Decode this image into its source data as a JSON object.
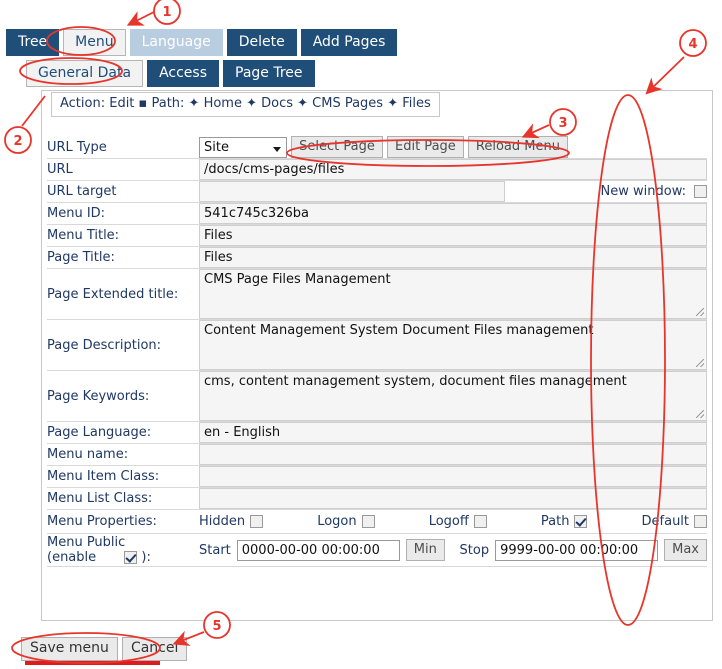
{
  "tabs_main": [
    {
      "label": "Tree",
      "state": "normal"
    },
    {
      "label": "Menu",
      "state": "active"
    },
    {
      "label": "Language",
      "state": "disabled"
    },
    {
      "label": "Delete",
      "state": "normal"
    },
    {
      "label": "Add Pages",
      "state": "normal"
    }
  ],
  "tabs_sub": [
    {
      "label": "General Data",
      "state": "active"
    },
    {
      "label": "Access",
      "state": "normal"
    },
    {
      "label": "Page Tree",
      "state": "normal"
    }
  ],
  "action_path": "Action: Edit ▪ Path: ✦ Home ✦ Docs ✦ CMS Pages ✦ Files",
  "form": {
    "url_type": {
      "label": "URL Type",
      "value": "Site",
      "buttons": [
        "Select Page",
        "Edit Page",
        "Reload Menu"
      ]
    },
    "url": {
      "label": "URL",
      "value": "/docs/cms-pages/files"
    },
    "url_target": {
      "label": "URL target",
      "value": "",
      "new_window_label": "New window:",
      "new_window_checked": false
    },
    "menu_id": {
      "label": "Menu ID:",
      "value": "541c745c326ba"
    },
    "menu_title": {
      "label": "Menu Title:",
      "value": "Files"
    },
    "page_title": {
      "label": "Page Title:",
      "value": "Files"
    },
    "page_extended_title": {
      "label": "Page Extended title:",
      "value": "CMS Page Files Management"
    },
    "page_description": {
      "label": "Page Description:",
      "value": "Content Management System Document Files management"
    },
    "page_keywords": {
      "label": "Page Keywords:",
      "value": "cms, content management system, document files management"
    },
    "page_language": {
      "label": "Page Language:",
      "value": "en - English"
    },
    "menu_name": {
      "label": "Menu name:",
      "value": ""
    },
    "menu_item_class": {
      "label": "Menu Item Class:",
      "value": ""
    },
    "menu_list_class": {
      "label": "Menu List Class:",
      "value": ""
    },
    "menu_properties": {
      "label": "Menu Properties:",
      "items": [
        {
          "label": "Hidden",
          "checked": false
        },
        {
          "label": "Logon",
          "checked": false
        },
        {
          "label": "Logoff",
          "checked": false
        },
        {
          "label": "Path",
          "checked": true
        },
        {
          "label": "Default",
          "checked": false
        }
      ]
    },
    "menu_public": {
      "label_line1": "Menu Public",
      "label_line2": "(enable",
      "checked": true,
      "suffix": "):",
      "start_label": "Start",
      "start_value": "0000-00-00 00:00:00",
      "min_label": "Min",
      "stop_label": "Stop",
      "stop_value": "9999-00-00 00:00:00",
      "max_label": "Max"
    }
  },
  "bottom_buttons": [
    {
      "label": "Save menu"
    },
    {
      "label": "Cancel"
    }
  ],
  "annotations": {
    "markers": [
      "1",
      "2",
      "3",
      "4",
      "5"
    ],
    "color": "#e8352c"
  },
  "colors": {
    "tab_active_bg": "#f2f2f2",
    "tab_bg": "#1F4E79",
    "tab_disabled_bg": "#b9cde0",
    "label_text": "#1F3864",
    "annotation_red": "#e8352c",
    "red_bar": "#e01b1b"
  }
}
